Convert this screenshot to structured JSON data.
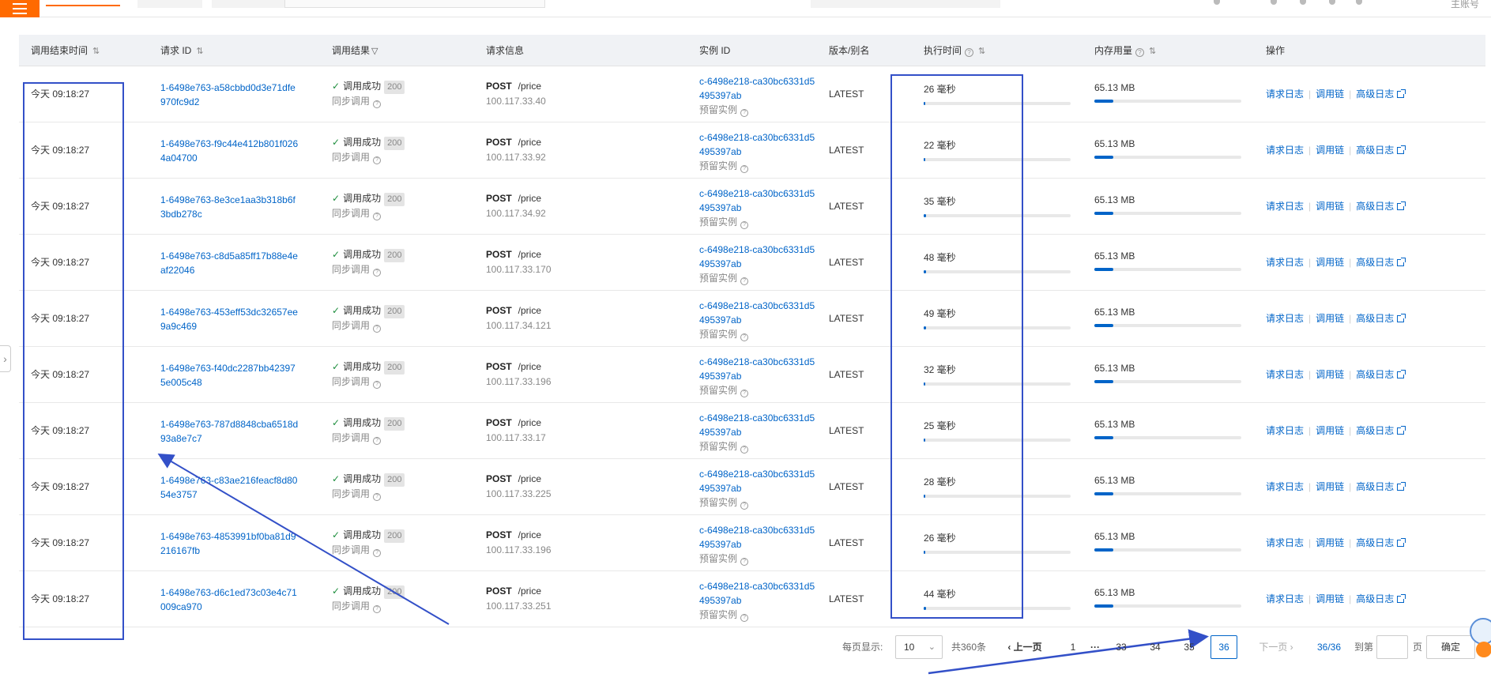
{
  "topbar": {
    "account": "主账号"
  },
  "table": {
    "headers": {
      "end_time": "调用结束时间",
      "request_id": "请求 ID",
      "result": "调用结果",
      "request_info": "请求信息",
      "instance_id": "实例 ID",
      "version": "版本/别名",
      "exec_time": "执行时间",
      "memory": "内存用量",
      "ops": "操作"
    },
    "rows": [
      {
        "time": "今天 09:18:27",
        "id": "1-6498e763-a58cbbd0d3e71dfe970fc9d2",
        "status": "调用成功",
        "code": "200",
        "mode": "同步调用",
        "method": "POST",
        "path": "/price",
        "ip": "100.117.33.40",
        "instance": "c-6498e218-ca30bc6331d5495397ab",
        "instance_type": "预留实例",
        "version": "LATEST",
        "exec": "26 毫秒",
        "exec_fraction": 0.012,
        "mem": "65.13 MB",
        "mem_fraction": 0.13
      },
      {
        "time": "今天 09:18:27",
        "id": "1-6498e763-f9c44e412b801f0264a04700",
        "status": "调用成功",
        "code": "200",
        "mode": "同步调用",
        "method": "POST",
        "path": "/price",
        "ip": "100.117.33.92",
        "instance": "c-6498e218-ca30bc6331d5495397ab",
        "instance_type": "预留实例",
        "version": "LATEST",
        "exec": "22 毫秒",
        "exec_fraction": 0.01,
        "mem": "65.13 MB",
        "mem_fraction": 0.13
      },
      {
        "time": "今天 09:18:27",
        "id": "1-6498e763-8e3ce1aa3b318b6f3bdb278c",
        "status": "调用成功",
        "code": "200",
        "mode": "同步调用",
        "method": "POST",
        "path": "/price",
        "ip": "100.117.34.92",
        "instance": "c-6498e218-ca30bc6331d5495397ab",
        "instance_type": "预留实例",
        "version": "LATEST",
        "exec": "35 毫秒",
        "exec_fraction": 0.014,
        "mem": "65.13 MB",
        "mem_fraction": 0.13
      },
      {
        "time": "今天 09:18:27",
        "id": "1-6498e763-c8d5a85ff17b88e4eaf22046",
        "status": "调用成功",
        "code": "200",
        "mode": "同步调用",
        "method": "POST",
        "path": "/price",
        "ip": "100.117.33.170",
        "instance": "c-6498e218-ca30bc6331d5495397ab",
        "instance_type": "预留实例",
        "version": "LATEST",
        "exec": "48 毫秒",
        "exec_fraction": 0.016,
        "mem": "65.13 MB",
        "mem_fraction": 0.13
      },
      {
        "time": "今天 09:18:27",
        "id": "1-6498e763-453eff53dc32657ee9a9c469",
        "status": "调用成功",
        "code": "200",
        "mode": "同步调用",
        "method": "POST",
        "path": "/price",
        "ip": "100.117.34.121",
        "instance": "c-6498e218-ca30bc6331d5495397ab",
        "instance_type": "预留实例",
        "version": "LATEST",
        "exec": "49 毫秒",
        "exec_fraction": 0.016,
        "mem": "65.13 MB",
        "mem_fraction": 0.13
      },
      {
        "time": "今天 09:18:27",
        "id": "1-6498e763-f40dc2287bb423975e005c48",
        "status": "调用成功",
        "code": "200",
        "mode": "同步调用",
        "method": "POST",
        "path": "/price",
        "ip": "100.117.33.196",
        "instance": "c-6498e218-ca30bc6331d5495397ab",
        "instance_type": "预留实例",
        "version": "LATEST",
        "exec": "32 毫秒",
        "exec_fraction": 0.013,
        "mem": "65.13 MB",
        "mem_fraction": 0.13
      },
      {
        "time": "今天 09:18:27",
        "id": "1-6498e763-787d8848cba6518d93a8e7c7",
        "status": "调用成功",
        "code": "200",
        "mode": "同步调用",
        "method": "POST",
        "path": "/price",
        "ip": "100.117.33.17",
        "instance": "c-6498e218-ca30bc6331d5495397ab",
        "instance_type": "预留实例",
        "version": "LATEST",
        "exec": "25 毫秒",
        "exec_fraction": 0.011,
        "mem": "65.13 MB",
        "mem_fraction": 0.13
      },
      {
        "time": "今天 09:18:27",
        "id": "1-6498e763-c83ae216feacf8d8054e3757",
        "status": "调用成功",
        "code": "200",
        "mode": "同步调用",
        "method": "POST",
        "path": "/price",
        "ip": "100.117.33.225",
        "instance": "c-6498e218-ca30bc6331d5495397ab",
        "instance_type": "预留实例",
        "version": "LATEST",
        "exec": "28 毫秒",
        "exec_fraction": 0.012,
        "mem": "65.13 MB",
        "mem_fraction": 0.13
      },
      {
        "time": "今天 09:18:27",
        "id": "1-6498e763-4853991bf0ba81d9216167fb",
        "status": "调用成功",
        "code": "200",
        "mode": "同步调用",
        "method": "POST",
        "path": "/price",
        "ip": "100.117.33.196",
        "instance": "c-6498e218-ca30bc6331d5495397ab",
        "instance_type": "预留实例",
        "version": "LATEST",
        "exec": "26 毫秒",
        "exec_fraction": 0.012,
        "mem": "65.13 MB",
        "mem_fraction": 0.13
      },
      {
        "time": "今天 09:18:27",
        "id": "1-6498e763-d6c1ed73c03e4c71009ca970",
        "status": "调用成功",
        "code": "200",
        "mode": "同步调用",
        "method": "POST",
        "path": "/price",
        "ip": "100.117.33.251",
        "instance": "c-6498e218-ca30bc6331d5495397ab",
        "instance_type": "预留实例",
        "version": "LATEST",
        "exec": "44 毫秒",
        "exec_fraction": 0.015,
        "mem": "65.13 MB",
        "mem_fraction": 0.13
      }
    ],
    "ops": {
      "request_log": "请求日志",
      "call_chain": "调用链",
      "advanced_log": "高级日志"
    }
  },
  "pagination": {
    "page_size_label": "每页显示:",
    "page_size": "10",
    "total": "共360条",
    "prev": "上一页",
    "next": "下一页",
    "pages": [
      "1",
      "···",
      "33",
      "34",
      "35",
      "36"
    ],
    "current": "36",
    "page_info": "36/36",
    "goto_label": "到第",
    "goto_suffix": "页",
    "confirm": "确定"
  },
  "colors": {
    "brand": "#ff6a00",
    "link": "#0064c8",
    "success": "#1e8e3e",
    "annotation": "#3350c8"
  }
}
